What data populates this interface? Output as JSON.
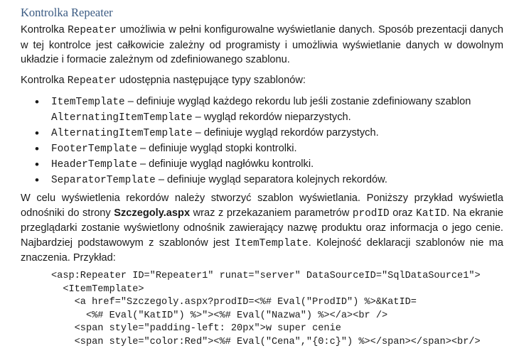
{
  "heading": "Kontrolka Repeater",
  "intro": {
    "t1": "Kontrolka ",
    "c1": "Repeater",
    "t2": " umożliwia w pełni konfigurowalne wyświetlanie danych. Sposób prezentacji danych w tej kontrolce jest całkowicie zależny od programisty i umożliwia wyświetlanie danych w dowolnym układzie i formacie zależnym od zdefiniowanego szablonu."
  },
  "templates_intro": {
    "t1": "Kontrolka ",
    "c1": "Repeater",
    "t2": " udostępnia następujące typy szablonów:"
  },
  "bullets": [
    {
      "code": "ItemTemplate",
      "text": " – definiuje wygląd każdego rekordu lub jeśli zostanie zdefiniowany szablon ",
      "code2": "AlternatingItemTemplate",
      "text2": " – wygląd rekordów nieparzystych."
    },
    {
      "code": "AlternatingItemTemplate",
      "text": " – definiuje wygląd rekordów parzystych."
    },
    {
      "code": "FooterTemplate",
      "text": " – definiuje wygląd stopki kontrolki."
    },
    {
      "code": "HeaderTemplate",
      "text": " – definiuje wygląd nagłówku kontrolki."
    },
    {
      "code": "SeparatorTemplate",
      "text": " – definiuje wygląd separatora kolejnych rekordów."
    }
  ],
  "example_para": {
    "t1": "W celu wyświetlenia rekordów należy stworzyć szablon wyświetlania. Poniższy przykład wyświetla odnośniki do strony ",
    "b1": "Szczegoly.aspx",
    "t2": " wraz z przekazaniem parametrów ",
    "c1": "prodID",
    "t3": " oraz ",
    "c2": "KatID",
    "t4": ". Na ekranie przeglądarki zostanie wyświetlony odnośnik zawierający nazwę produktu oraz informacja o jego cenie. Najbardziej podstawowym z szablonów jest ",
    "c3": "ItemTemplate",
    "t5": ". Kolejność deklaracji szablonów nie ma znaczenia. Przykład:"
  },
  "code_lines": [
    "<asp:Repeater ID=\"Repeater1\" runat=\"server\" DataSourceID=\"SqlDataSource1\">",
    "  <ItemTemplate>",
    "    <a href=\"Szczegoly.aspx?prodID=<%# Eval(\"ProdID\") %>&KatID=",
    "      <%# Eval(\"KatID\") %>\"><%# Eval(\"Nazwa\") %></a><br />",
    "    <span style=\"padding-left: 20px\">w super cenie",
    "    <span style=\"color:Red\"><%# Eval(\"Cena\",\"{0:c}\") %></span></span><br/>"
  ]
}
